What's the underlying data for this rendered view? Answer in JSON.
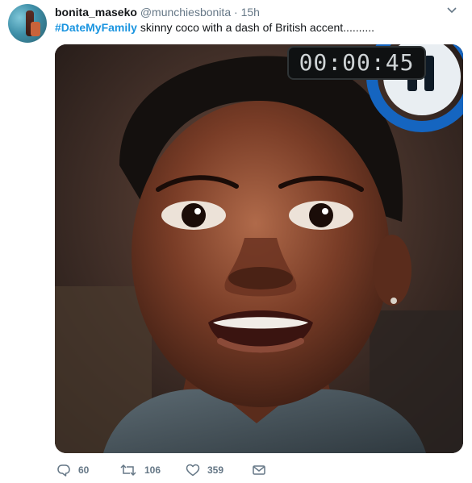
{
  "tweet": {
    "display_name": "bonita_maseko",
    "handle": "@munchiesbonita",
    "separator": "·",
    "time": "15h",
    "hashtag": "#DateMyFamily",
    "text": " skinny coco with a dash of British accent.........."
  },
  "media": {
    "timer": "00:00:45",
    "pause_icon": "pause-icon"
  },
  "actions": {
    "reply_count": "60",
    "retweet_count": "106",
    "like_count": "359",
    "icons": [
      "reply-icon",
      "retweet-icon",
      "like-icon",
      "direct-message-icon"
    ]
  },
  "colors": {
    "accent": "#1b95e0",
    "muted": "#657786",
    "text": "#14171a"
  }
}
